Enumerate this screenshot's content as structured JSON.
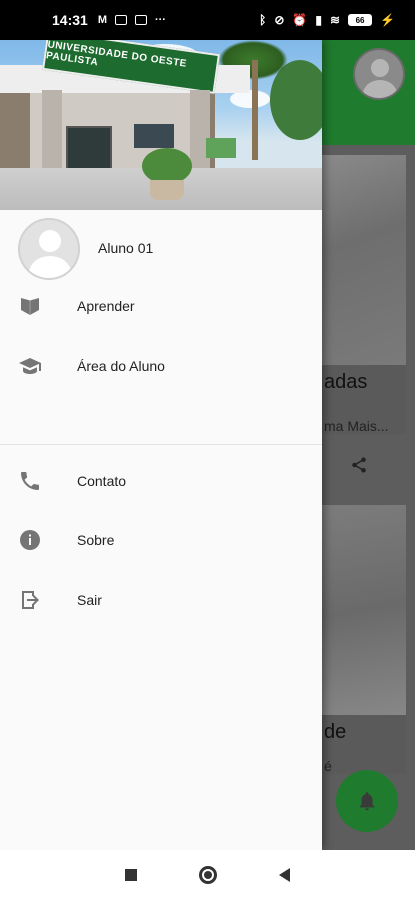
{
  "status_bar": {
    "time": "14:31",
    "battery": "66",
    "left_icons": [
      "gmail-icon",
      "message-icon",
      "notification-icon",
      "more-dots-icon"
    ],
    "right_icons": [
      "bluetooth-icon",
      "dnd-icon",
      "alarm-icon",
      "signal-icon",
      "wifi-icon",
      "battery-icon",
      "charging-icon"
    ]
  },
  "header_image": {
    "sign_text": "UNIVERSIDADE DO OESTE PAULISTA"
  },
  "drawer": {
    "user_name": "Aluno 01",
    "items": [
      {
        "label": "Aprender",
        "icon": "book-icon"
      },
      {
        "label": "Área do Aluno",
        "icon": "graduation-cap-icon"
      },
      {
        "label": "Contato",
        "icon": "phone-icon"
      },
      {
        "label": "Sobre",
        "icon": "info-icon"
      },
      {
        "label": "Sair",
        "icon": "logout-icon"
      }
    ]
  },
  "background": {
    "card1_title": "adas",
    "card1_subtitle": "ma Mais...",
    "card2_title": "de",
    "card2_subtitle": "é"
  },
  "colors": {
    "brand_green": "#1f7b2d",
    "drawer_bg": "#fafafa",
    "scrim": "#5d5d5d"
  }
}
